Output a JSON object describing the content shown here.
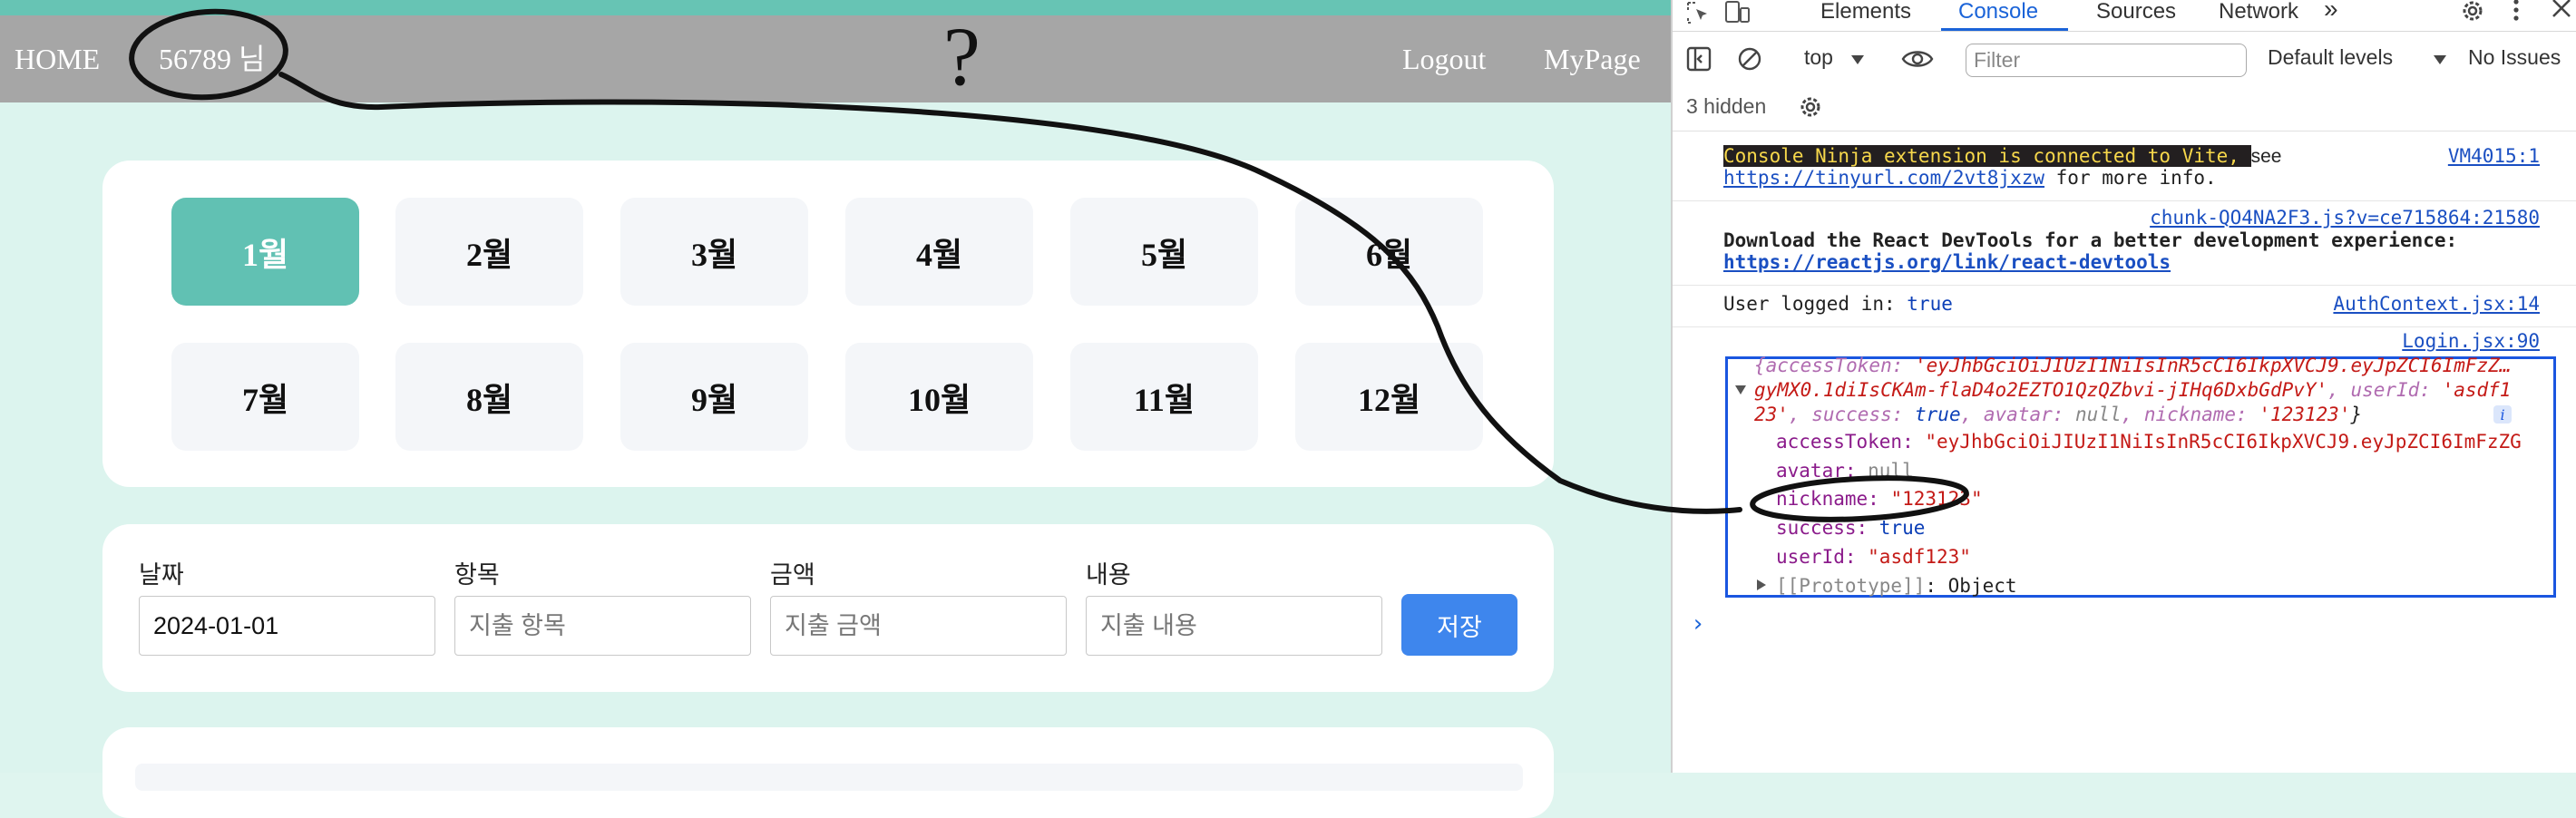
{
  "nav": {
    "home": "HOME",
    "user": "56789 님",
    "logout": "Logout",
    "mypage": "MyPage"
  },
  "annotation": {
    "question_mark": "?"
  },
  "months": [
    {
      "label": "1월",
      "active": true
    },
    {
      "label": "2월"
    },
    {
      "label": "3월"
    },
    {
      "label": "4월"
    },
    {
      "label": "5월"
    },
    {
      "label": "6월"
    },
    {
      "label": "7월"
    },
    {
      "label": "8월"
    },
    {
      "label": "9월"
    },
    {
      "label": "10월"
    },
    {
      "label": "11월"
    },
    {
      "label": "12월"
    }
  ],
  "form": {
    "date_label": "날짜",
    "date_value": "2024-01-01",
    "item_label": "항목",
    "item_placeholder": "지출 항목",
    "amount_label": "금액",
    "amount_placeholder": "지출 금액",
    "content_label": "내용",
    "content_placeholder": "지출 내용",
    "save": "저장"
  },
  "devtools": {
    "tabs": [
      "Elements",
      "Console",
      "Sources",
      "Network"
    ],
    "active_tab": "Console",
    "more": "»",
    "context": "top",
    "filter_placeholder": "Filter",
    "levels": "Default levels",
    "issues": "No Issues",
    "hidden": "3 hidden",
    "console": {
      "ninja_badge": " Console Ninja extension is connected to Vite, ",
      "ninja_see": "see",
      "ninja_url": "https://tinyurl.com/2vt8jxzw",
      "ninja_more": " for more info.",
      "ninja_src": "VM4015:1",
      "react_src": "chunk-QO4NA2F3.js?v=ce715864:21580",
      "react_msg": "Download the React DevTools for a better development experience:",
      "react_url": "https://reactjs.org/link/react-devtools",
      "auth_msg": "User logged in: ",
      "auth_val": "true",
      "auth_src": "AuthContext.jsx:14",
      "login_src": "Login.jsx:90",
      "obj_line1_a": "{accessToken: ",
      "obj_line1_b": "'eyJhbGciOiJIUzI1NiIsInR5cCI6IkpXVCJ9.eyJpZCI6ImFzZ…",
      "obj_line2_a": "gyMX0.1diIsCKAm-flaD4o2EZTO1QzQZbvi-jIHq6DxbGdPvY'",
      "obj_line2_b": ", userId: ",
      "obj_line2_c": "'asdf1",
      "obj_line3_a": "23'",
      "obj_line3_b": ", success: ",
      "obj_line3_c": "true",
      "obj_line3_d": ", avatar: ",
      "obj_line3_e": "null",
      "obj_line3_f": ", nickname: ",
      "obj_line3_g": "'123123'",
      "obj_line3_h": "}",
      "p_access_key": "accessToken: ",
      "p_access_val": "\"eyJhbGciOiJIUzI1NiIsInR5cCI6IkpXVCJ9.eyJpZCI6ImFzZG",
      "p_avatar_key": "avatar: ",
      "p_avatar_val": "null",
      "p_nick_key": "nickname: ",
      "p_nick_val": "\"123123\"",
      "p_success_key": "success: ",
      "p_success_val": "true",
      "p_user_key": "userId: ",
      "p_user_val": "\"asdf123\"",
      "p_proto": "[[Prototype]]",
      "p_proto_val": ": Object",
      "prompt": "›"
    }
  },
  "colors": {
    "accent": "#61c1b3",
    "save_button": "#3e86ed",
    "devtools_blue": "#1a63d8"
  }
}
